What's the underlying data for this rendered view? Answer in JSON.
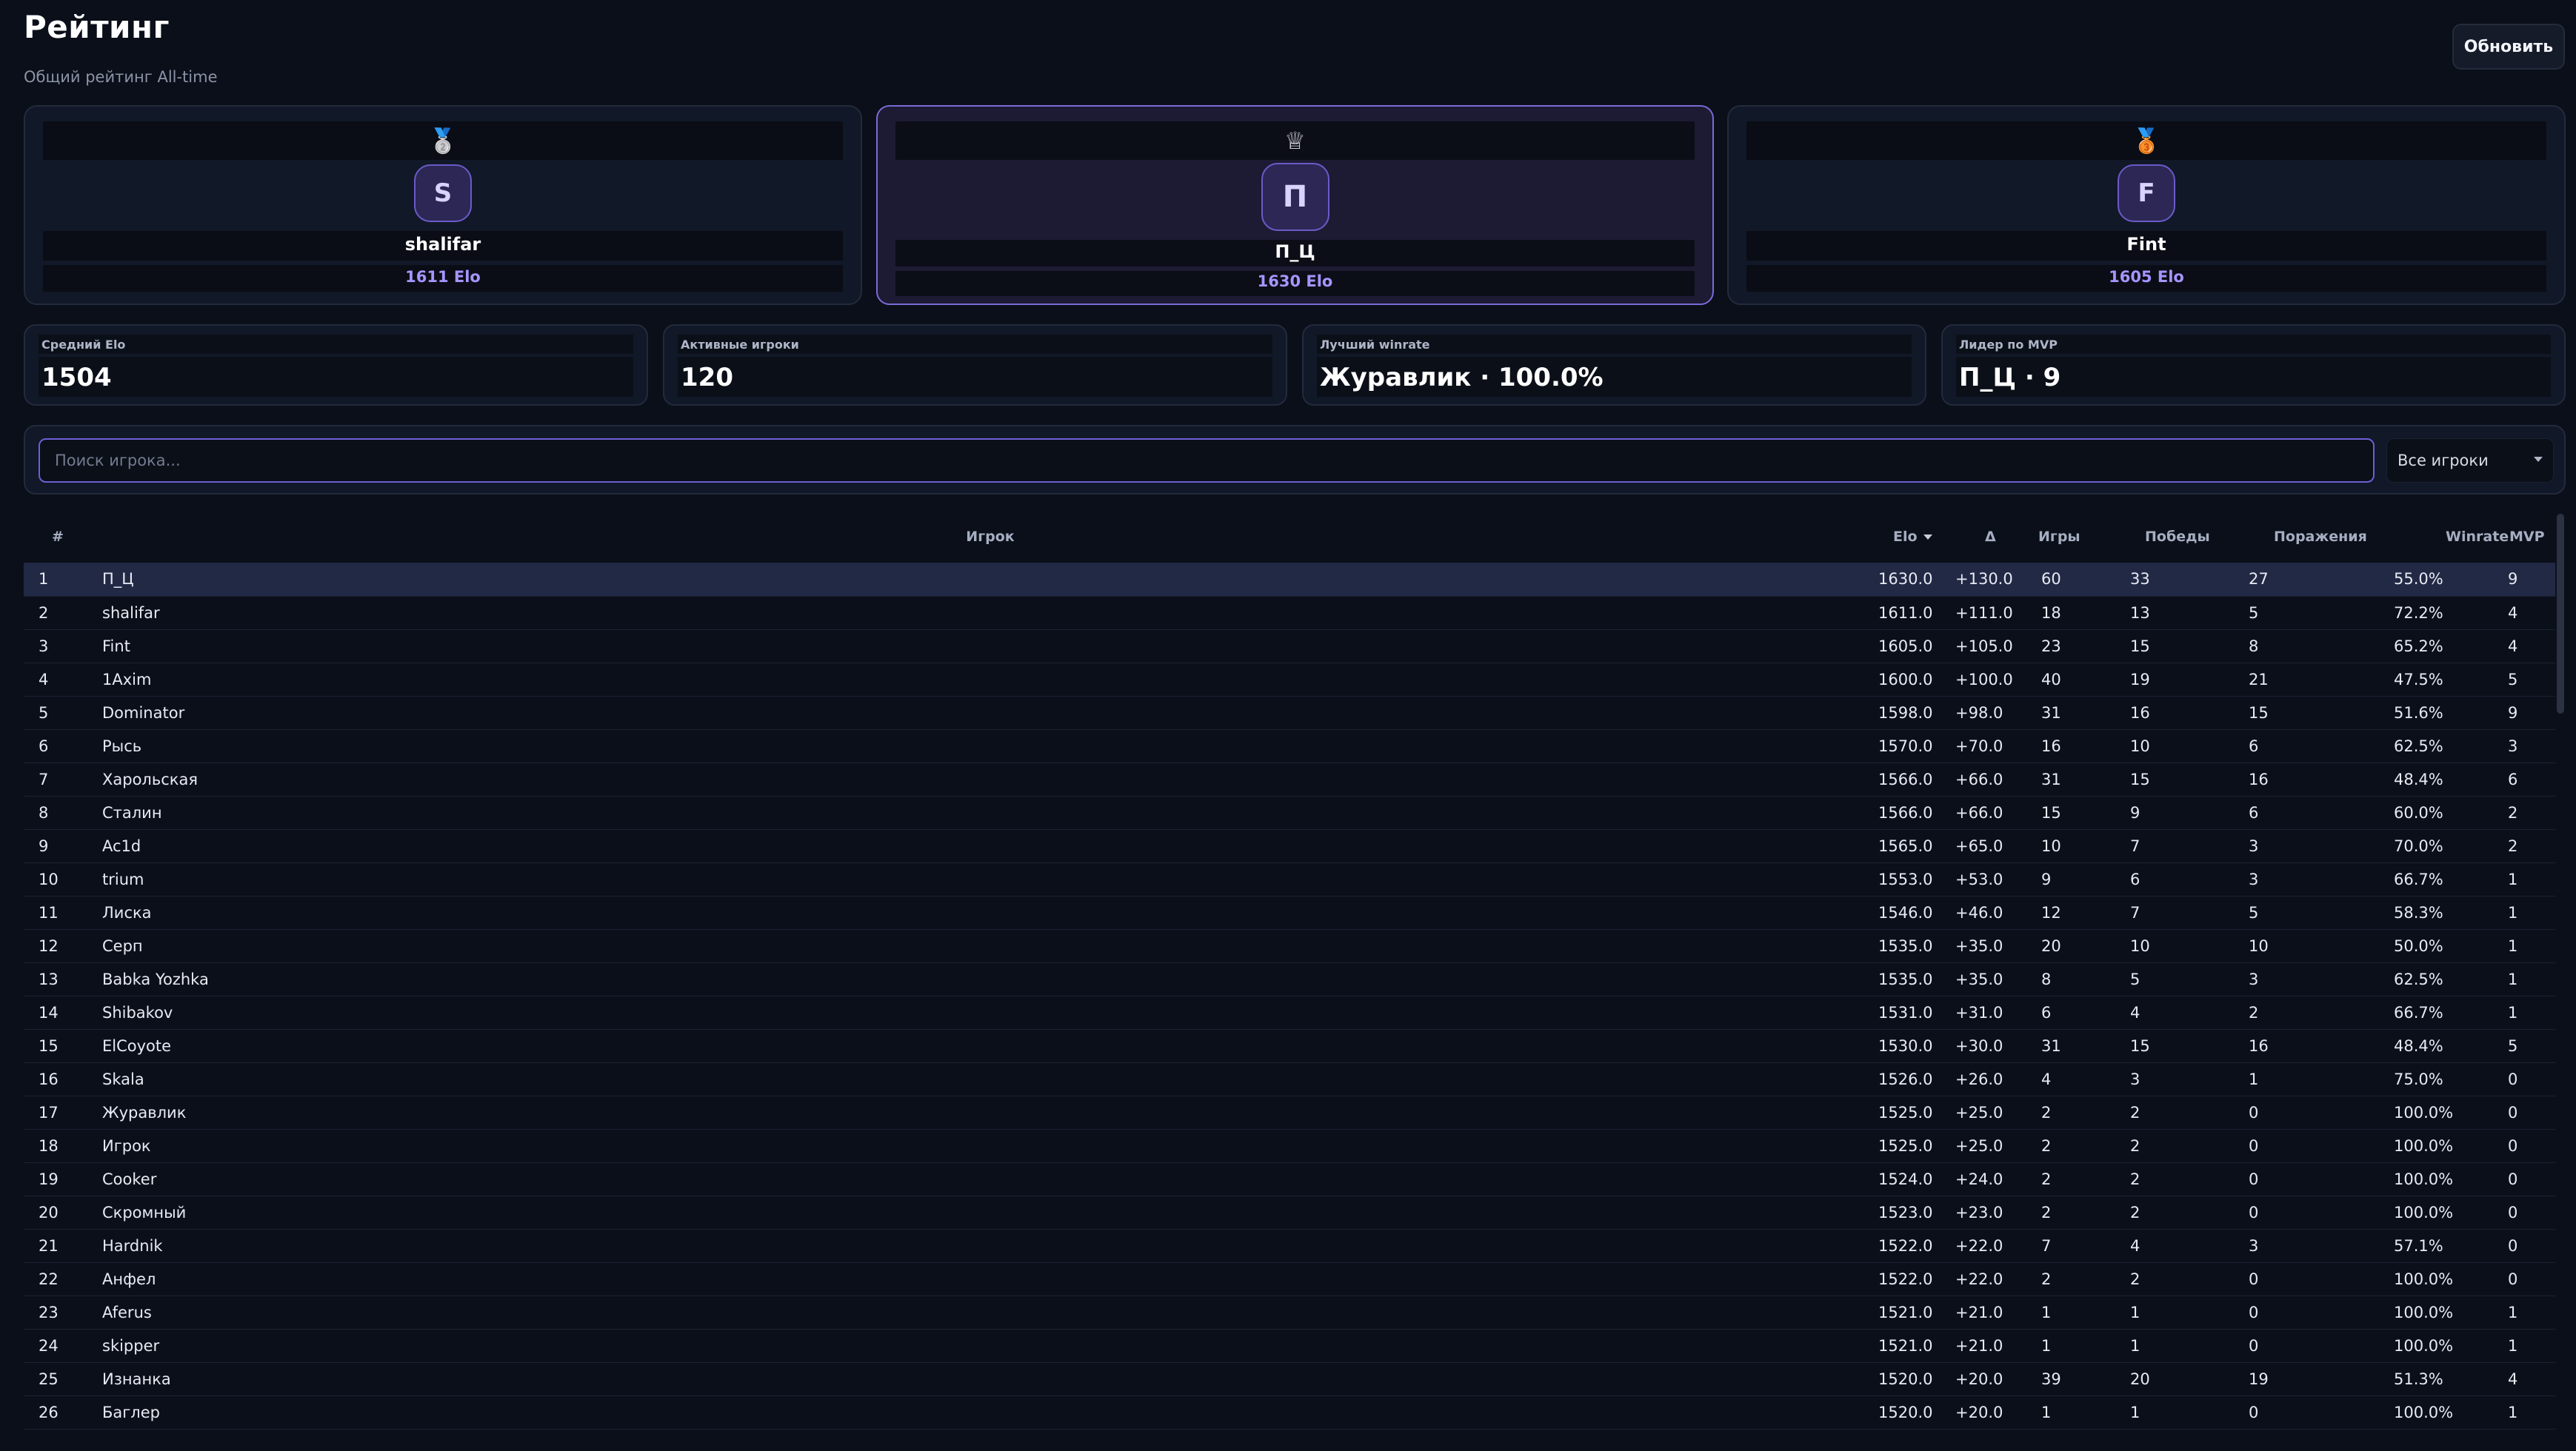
{
  "header": {
    "title": "Рейтинг",
    "subtitle": "Общий рейтинг All-time",
    "refresh_label": "Обновить"
  },
  "podium": [
    {
      "place": 2,
      "medal_icon": "silver-medal-icon",
      "medal_glyph": "🥈",
      "initial": "S",
      "name": "shalifar",
      "elo": "1611 Elo"
    },
    {
      "place": 1,
      "medal_icon": "crown-icon",
      "medal_glyph": "♕",
      "initial": "П",
      "name": "П_Ц",
      "elo": "1630 Elo"
    },
    {
      "place": 3,
      "medal_icon": "bronze-medal-icon",
      "medal_glyph": "🥉",
      "initial": "F",
      "name": "Fint",
      "elo": "1605 Elo"
    }
  ],
  "stats": [
    {
      "label": "Средний Elo",
      "value": "1504"
    },
    {
      "label": "Активные игроки",
      "value": "120"
    },
    {
      "label": "Лучший winrate",
      "value": "Журавлик · 100.0%"
    },
    {
      "label": "Лидер по MVP",
      "value": "П_Ц · 9"
    }
  ],
  "search": {
    "placeholder": "Поиск игрока...",
    "value": "",
    "filter_value": "Все игроки"
  },
  "table": {
    "columns": [
      "#",
      "Игрок",
      "Elo",
      "Δ",
      "Игры",
      "Победы",
      "Поражения",
      "Winrate",
      "MVP"
    ],
    "sorted_column": "Elo",
    "rows": [
      [
        "1",
        "П_Ц",
        "1630.0",
        "+130.0",
        "60",
        "33",
        "27",
        "55.0%",
        "9"
      ],
      [
        "2",
        "shalifar",
        "1611.0",
        "+111.0",
        "18",
        "13",
        "5",
        "72.2%",
        "4"
      ],
      [
        "3",
        "Fint",
        "1605.0",
        "+105.0",
        "23",
        "15",
        "8",
        "65.2%",
        "4"
      ],
      [
        "4",
        "1Axim",
        "1600.0",
        "+100.0",
        "40",
        "19",
        "21",
        "47.5%",
        "5"
      ],
      [
        "5",
        "Dominator",
        "1598.0",
        "+98.0",
        "31",
        "16",
        "15",
        "51.6%",
        "9"
      ],
      [
        "6",
        "Рысь",
        "1570.0",
        "+70.0",
        "16",
        "10",
        "6",
        "62.5%",
        "3"
      ],
      [
        "7",
        "Харольская",
        "1566.0",
        "+66.0",
        "31",
        "15",
        "16",
        "48.4%",
        "6"
      ],
      [
        "8",
        "Сталин",
        "1566.0",
        "+66.0",
        "15",
        "9",
        "6",
        "60.0%",
        "2"
      ],
      [
        "9",
        "Ac1d",
        "1565.0",
        "+65.0",
        "10",
        "7",
        "3",
        "70.0%",
        "2"
      ],
      [
        "10",
        "trium",
        "1553.0",
        "+53.0",
        "9",
        "6",
        "3",
        "66.7%",
        "1"
      ],
      [
        "11",
        "Лиска",
        "1546.0",
        "+46.0",
        "12",
        "7",
        "5",
        "58.3%",
        "1"
      ],
      [
        "12",
        "Серп",
        "1535.0",
        "+35.0",
        "20",
        "10",
        "10",
        "50.0%",
        "1"
      ],
      [
        "13",
        "Babka Yozhka",
        "1535.0",
        "+35.0",
        "8",
        "5",
        "3",
        "62.5%",
        "1"
      ],
      [
        "14",
        "Shibakov",
        "1531.0",
        "+31.0",
        "6",
        "4",
        "2",
        "66.7%",
        "1"
      ],
      [
        "15",
        "ElCoyote",
        "1530.0",
        "+30.0",
        "31",
        "15",
        "16",
        "48.4%",
        "5"
      ],
      [
        "16",
        "Skala",
        "1526.0",
        "+26.0",
        "4",
        "3",
        "1",
        "75.0%",
        "0"
      ],
      [
        "17",
        "Журавлик",
        "1525.0",
        "+25.0",
        "2",
        "2",
        "0",
        "100.0%",
        "0"
      ],
      [
        "18",
        "Игрок",
        "1525.0",
        "+25.0",
        "2",
        "2",
        "0",
        "100.0%",
        "0"
      ],
      [
        "19",
        "Cooker",
        "1524.0",
        "+24.0",
        "2",
        "2",
        "0",
        "100.0%",
        "0"
      ],
      [
        "20",
        "Скромный",
        "1523.0",
        "+23.0",
        "2",
        "2",
        "0",
        "100.0%",
        "0"
      ],
      [
        "21",
        "Hardnik",
        "1522.0",
        "+22.0",
        "7",
        "4",
        "3",
        "57.1%",
        "0"
      ],
      [
        "22",
        "Анфел",
        "1522.0",
        "+22.0",
        "2",
        "2",
        "0",
        "100.0%",
        "0"
      ],
      [
        "23",
        "Aferus",
        "1521.0",
        "+21.0",
        "1",
        "1",
        "0",
        "100.0%",
        "1"
      ],
      [
        "24",
        "skipper",
        "1521.0",
        "+21.0",
        "1",
        "1",
        "0",
        "100.0%",
        "1"
      ],
      [
        "25",
        "Изнанка",
        "1520.0",
        "+20.0",
        "39",
        "20",
        "19",
        "51.3%",
        "4"
      ],
      [
        "26",
        "Баглер",
        "1520.0",
        "+20.0",
        "1",
        "1",
        "0",
        "100.0%",
        "1"
      ]
    ]
  },
  "colors": {
    "background": "#0b0f19",
    "card": "#111827",
    "accent": "#7b6bd6",
    "elo_text": "#a595ff",
    "highlight_row": "#222945"
  }
}
